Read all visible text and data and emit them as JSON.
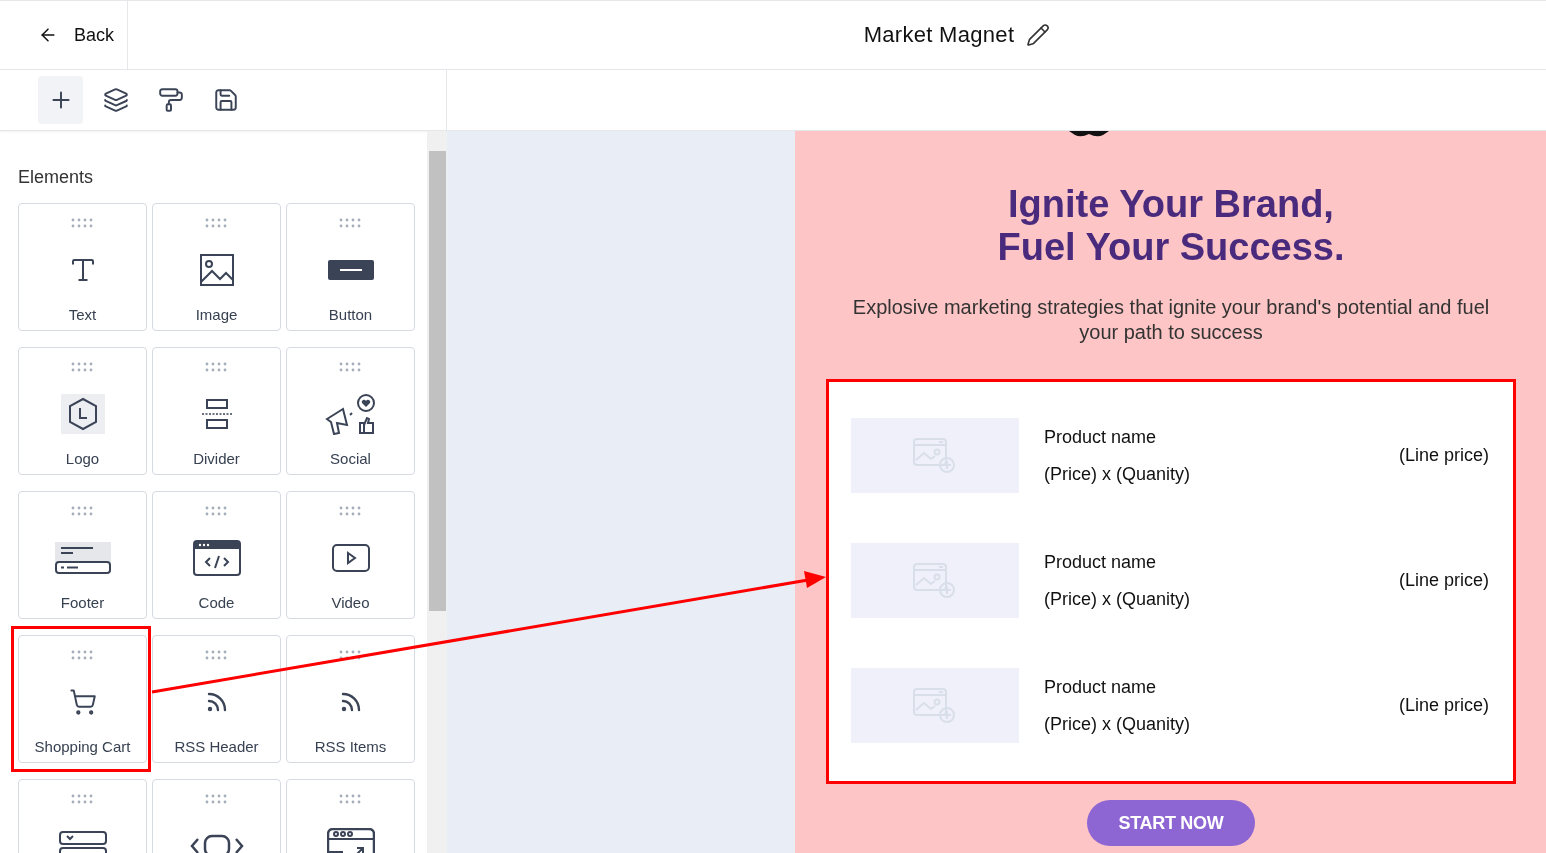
{
  "header": {
    "back": "Back",
    "title": "Market Magnet"
  },
  "tools": [
    {
      "kind": "add",
      "selected": true
    },
    {
      "kind": "layers",
      "selected": false
    },
    {
      "kind": "style",
      "selected": false
    },
    {
      "kind": "save",
      "selected": false
    }
  ],
  "panel": {
    "heading": "Elements",
    "elements": [
      {
        "label": "Text",
        "kind": "text",
        "highlighted": false
      },
      {
        "label": "Image",
        "kind": "image",
        "highlighted": false
      },
      {
        "label": "Button",
        "kind": "button",
        "highlighted": false
      },
      {
        "label": "Logo",
        "kind": "logo",
        "highlighted": false
      },
      {
        "label": "Divider",
        "kind": "divider",
        "highlighted": false
      },
      {
        "label": "Social",
        "kind": "social",
        "highlighted": false
      },
      {
        "label": "Footer",
        "kind": "footer",
        "highlighted": false
      },
      {
        "label": "Code",
        "kind": "code",
        "highlighted": false
      },
      {
        "label": "Video",
        "kind": "video",
        "highlighted": false
      },
      {
        "label": "Shopping Cart",
        "kind": "cart",
        "highlighted": true
      },
      {
        "label": "RSS Header",
        "kind": "rss",
        "highlighted": false
      },
      {
        "label": "RSS Items",
        "kind": "rss",
        "highlighted": false
      },
      {
        "kind": "form",
        "highlighted": false
      },
      {
        "kind": "embed",
        "highlighted": false
      },
      {
        "kind": "browser",
        "highlighted": false
      }
    ]
  },
  "email": {
    "heading": "Ignite Your Brand,\nFuel Your Success.",
    "subtitle": "Explosive marketing strategies that ignite your brand's potential and fuel your path to success",
    "cart": {
      "highlighted": true,
      "items": [
        {
          "name": "Product name",
          "quantity": "(Price) x (Quanity)",
          "line_price": "(Line price)"
        },
        {
          "name": "Product name",
          "quantity": "(Price) x (Quanity)",
          "line_price": "(Line price)"
        },
        {
          "name": "Product name",
          "quantity": "(Price) x (Quanity)",
          "line_price": "(Line price)"
        }
      ]
    },
    "button": "START NOW"
  }
}
